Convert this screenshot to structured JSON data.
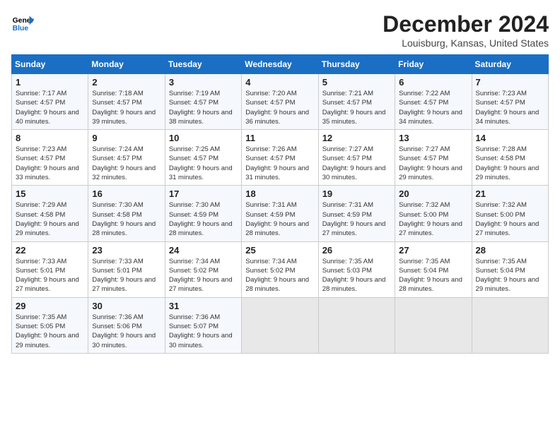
{
  "header": {
    "logo_line1": "General",
    "logo_line2": "Blue",
    "title": "December 2024",
    "location": "Louisburg, Kansas, United States"
  },
  "days_of_week": [
    "Sunday",
    "Monday",
    "Tuesday",
    "Wednesday",
    "Thursday",
    "Friday",
    "Saturday"
  ],
  "weeks": [
    [
      {
        "day": "1",
        "sunrise": "7:17 AM",
        "sunset": "4:57 PM",
        "daylight": "9 hours and 40 minutes."
      },
      {
        "day": "2",
        "sunrise": "7:18 AM",
        "sunset": "4:57 PM",
        "daylight": "9 hours and 39 minutes."
      },
      {
        "day": "3",
        "sunrise": "7:19 AM",
        "sunset": "4:57 PM",
        "daylight": "9 hours and 38 minutes."
      },
      {
        "day": "4",
        "sunrise": "7:20 AM",
        "sunset": "4:57 PM",
        "daylight": "9 hours and 36 minutes."
      },
      {
        "day": "5",
        "sunrise": "7:21 AM",
        "sunset": "4:57 PM",
        "daylight": "9 hours and 35 minutes."
      },
      {
        "day": "6",
        "sunrise": "7:22 AM",
        "sunset": "4:57 PM",
        "daylight": "9 hours and 34 minutes."
      },
      {
        "day": "7",
        "sunrise": "7:23 AM",
        "sunset": "4:57 PM",
        "daylight": "9 hours and 34 minutes."
      }
    ],
    [
      {
        "day": "8",
        "sunrise": "7:23 AM",
        "sunset": "4:57 PM",
        "daylight": "9 hours and 33 minutes."
      },
      {
        "day": "9",
        "sunrise": "7:24 AM",
        "sunset": "4:57 PM",
        "daylight": "9 hours and 32 minutes."
      },
      {
        "day": "10",
        "sunrise": "7:25 AM",
        "sunset": "4:57 PM",
        "daylight": "9 hours and 31 minutes."
      },
      {
        "day": "11",
        "sunrise": "7:26 AM",
        "sunset": "4:57 PM",
        "daylight": "9 hours and 31 minutes."
      },
      {
        "day": "12",
        "sunrise": "7:27 AM",
        "sunset": "4:57 PM",
        "daylight": "9 hours and 30 minutes."
      },
      {
        "day": "13",
        "sunrise": "7:27 AM",
        "sunset": "4:57 PM",
        "daylight": "9 hours and 29 minutes."
      },
      {
        "day": "14",
        "sunrise": "7:28 AM",
        "sunset": "4:58 PM",
        "daylight": "9 hours and 29 minutes."
      }
    ],
    [
      {
        "day": "15",
        "sunrise": "7:29 AM",
        "sunset": "4:58 PM",
        "daylight": "9 hours and 29 minutes."
      },
      {
        "day": "16",
        "sunrise": "7:30 AM",
        "sunset": "4:58 PM",
        "daylight": "9 hours and 28 minutes."
      },
      {
        "day": "17",
        "sunrise": "7:30 AM",
        "sunset": "4:59 PM",
        "daylight": "9 hours and 28 minutes."
      },
      {
        "day": "18",
        "sunrise": "7:31 AM",
        "sunset": "4:59 PM",
        "daylight": "9 hours and 28 minutes."
      },
      {
        "day": "19",
        "sunrise": "7:31 AM",
        "sunset": "4:59 PM",
        "daylight": "9 hours and 27 minutes."
      },
      {
        "day": "20",
        "sunrise": "7:32 AM",
        "sunset": "5:00 PM",
        "daylight": "9 hours and 27 minutes."
      },
      {
        "day": "21",
        "sunrise": "7:32 AM",
        "sunset": "5:00 PM",
        "daylight": "9 hours and 27 minutes."
      }
    ],
    [
      {
        "day": "22",
        "sunrise": "7:33 AM",
        "sunset": "5:01 PM",
        "daylight": "9 hours and 27 minutes."
      },
      {
        "day": "23",
        "sunrise": "7:33 AM",
        "sunset": "5:01 PM",
        "daylight": "9 hours and 27 minutes."
      },
      {
        "day": "24",
        "sunrise": "7:34 AM",
        "sunset": "5:02 PM",
        "daylight": "9 hours and 27 minutes."
      },
      {
        "day": "25",
        "sunrise": "7:34 AM",
        "sunset": "5:02 PM",
        "daylight": "9 hours and 28 minutes."
      },
      {
        "day": "26",
        "sunrise": "7:35 AM",
        "sunset": "5:03 PM",
        "daylight": "9 hours and 28 minutes."
      },
      {
        "day": "27",
        "sunrise": "7:35 AM",
        "sunset": "5:04 PM",
        "daylight": "9 hours and 28 minutes."
      },
      {
        "day": "28",
        "sunrise": "7:35 AM",
        "sunset": "5:04 PM",
        "daylight": "9 hours and 29 minutes."
      }
    ],
    [
      {
        "day": "29",
        "sunrise": "7:35 AM",
        "sunset": "5:05 PM",
        "daylight": "9 hours and 29 minutes."
      },
      {
        "day": "30",
        "sunrise": "7:36 AM",
        "sunset": "5:06 PM",
        "daylight": "9 hours and 30 minutes."
      },
      {
        "day": "31",
        "sunrise": "7:36 AM",
        "sunset": "5:07 PM",
        "daylight": "9 hours and 30 minutes."
      },
      null,
      null,
      null,
      null
    ]
  ],
  "labels": {
    "sunrise": "Sunrise:",
    "sunset": "Sunset:",
    "daylight": "Daylight:"
  }
}
